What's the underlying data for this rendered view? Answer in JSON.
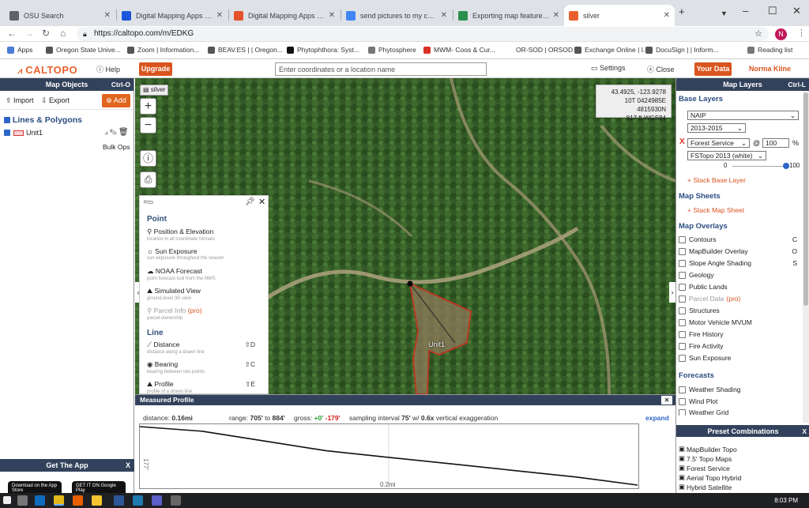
{
  "browser": {
    "tabs": [
      {
        "label": "OSU Search",
        "color": "#5f6368"
      },
      {
        "label": "Digital Mapping Apps for W",
        "color": "#1a56db"
      },
      {
        "label": "Digital Mapping Apps for W",
        "color": "#e3522b"
      },
      {
        "label": "send pictures to my comp",
        "color": "#4285f4"
      },
      {
        "label": "Exporting map features fro",
        "color": "#2d8f4e"
      },
      {
        "label": "silver",
        "color": "#e8612c"
      }
    ],
    "new_tab": "+",
    "url": "https://caltopo.com/m/EDKG",
    "avatar": "N",
    "bookmarks": [
      {
        "label": "Apps",
        "color": "#4a7bd6"
      },
      {
        "label": "Oregon State Unive...",
        "color": "#555"
      },
      {
        "label": "Zoom | Information...",
        "color": "#555"
      },
      {
        "label": "BEAV.ES | | Oregon...",
        "color": "#555"
      },
      {
        "label": "Phytophthora: Syst...",
        "color": "#111"
      },
      {
        "label": "Phytosphere",
        "color": "#777"
      },
      {
        "label": "MWM- Coos & Cur...",
        "color": "#d93025"
      },
      {
        "label": "OR-SOD | ORSOD",
        "color": "#fff"
      },
      {
        "label": "Exchange Online | I...",
        "color": "#555"
      },
      {
        "label": "DocuSign | | Inform...",
        "color": "#555"
      }
    ],
    "reading_list": "Reading list"
  },
  "header": {
    "logo": "CALTOPO",
    "help": "Help",
    "upgrade": "Upgrade",
    "coord_placeholder": "Enter coordinates or a location name",
    "settings": "Settings",
    "close": "Close",
    "your_data": "Your Data",
    "user": "Norma Kline"
  },
  "left": {
    "title": "Map Objects",
    "shortcut": "Ctrl-O",
    "import": "Import",
    "export": "Export",
    "add": "Add",
    "section": "Lines & Polygons",
    "item": "Unit1",
    "bulk": "Bulk Ops",
    "get_app": "Get The App",
    "get_app_x": "X",
    "app_store": "Download on the App Store",
    "google_play": "GET IT ON Google Play"
  },
  "map": {
    "layer_tag": "silver",
    "zoom_in": "+",
    "zoom_out": "−",
    "coords": [
      "43.4925, -123.9278",
      "10T 0424985E 4815930N",
      "817 ft     WGS84"
    ],
    "unit_label": "Unit1"
  },
  "tools": {
    "point_section": "Point",
    "line_section": "Line",
    "point_items": [
      {
        "label": "Position & Elevation",
        "sub": "location in all coordinate formats"
      },
      {
        "label": "Sun Exposure",
        "sub": "sun exposure throughout the season"
      },
      {
        "label": "NOAA Forecast",
        "sub": "point forecast tool from the NWS"
      },
      {
        "label": "Simulated View",
        "sub": "ground-level 3D view"
      },
      {
        "label": "Parcel Info",
        "pro": "(pro)",
        "sub": "parcel ownership"
      }
    ],
    "line_items": [
      {
        "label": "Distance",
        "sub": "distance along a drawn line",
        "key": "⇧D"
      },
      {
        "label": "Bearing",
        "sub": "bearing between two points",
        "key": "⇧C"
      },
      {
        "label": "Profile",
        "sub": "profile of a drawn line",
        "key": "⇧E"
      }
    ]
  },
  "profile": {
    "title": "Measured Profile",
    "distance_label": "distance:",
    "distance": "0.16mi",
    "range_label": "range:",
    "range_a": "705'",
    "range_to": "to",
    "range_b": "884'",
    "gross_label": "gross:",
    "gross_up": "+0'",
    "gross_down": "-179'",
    "sampling_label": "sampling interval",
    "sampling": "75'",
    "w": "w/",
    "exag": "0.6x",
    "exag_label": "vertical exaggeration",
    "expand": "expand",
    "y_tick": "177'",
    "x_tick": "0.2mi",
    "close": "✕"
  },
  "chart_data": {
    "type": "line",
    "xlabel": "",
    "ylabel": "",
    "x": [
      0,
      0.02,
      0.04,
      0.06,
      0.08,
      0.1,
      0.12,
      0.14,
      0.16
    ],
    "values": [
      884,
      870,
      840,
      810,
      790,
      770,
      750,
      730,
      705
    ],
    "ylim": [
      705,
      884
    ]
  },
  "right": {
    "title": "Map Layers",
    "shortcut": "Ctrl-L",
    "base_layers": "Base Layers",
    "base": "NAIP",
    "years": "2013-2015",
    "x_mark": "X",
    "forest": "Forest Service",
    "at": "@",
    "opacity": "100",
    "pct": "%",
    "fstopo": "FSTopo 2013 (white)",
    "slider_min": "0",
    "slider_max": "100",
    "slider_value": 100,
    "stack_base": "+ Stack Base Layer",
    "map_sheets": "Map Sheets",
    "stack_sheet": "+ Stack Map Sheet",
    "overlays_title": "Map Overlays",
    "overlays": [
      {
        "label": "Contours",
        "key": "C"
      },
      {
        "label": "MapBuilder Overlay",
        "key": "O"
      },
      {
        "label": "Slope Angle Shading",
        "key": "S"
      },
      {
        "label": "Geology",
        "key": ""
      },
      {
        "label": "Public Lands",
        "key": ""
      },
      {
        "label": "Parcel Data",
        "key": ""
      },
      {
        "label": "Structures",
        "key": ""
      },
      {
        "label": "Motor Vehicle MVUM",
        "key": ""
      },
      {
        "label": "Fire History",
        "key": ""
      },
      {
        "label": "Fire Activity",
        "key": ""
      },
      {
        "label": "Sun Exposure",
        "key": ""
      }
    ],
    "parcel_pro": "(pro)",
    "forecasts": "Forecasts",
    "forecast_items": [
      "Weather Shading",
      "Wind Plot",
      "Weather Grid"
    ],
    "preset": "Preset Combinations",
    "preset_x": "X",
    "presets": [
      "MapBuilder Topo",
      "7.5' Topo Maps",
      "Forest Service",
      "Aerial Topo Hybrid",
      "Hybrid Satellite"
    ]
  },
  "taskbar": {
    "time": "8:03 PM"
  }
}
